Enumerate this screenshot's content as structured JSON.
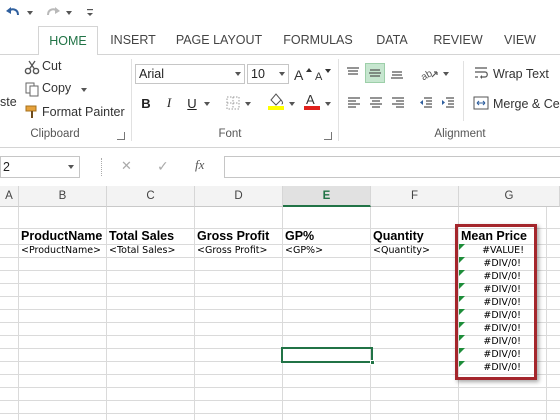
{
  "quick_access": {
    "icons": [
      "undo-icon",
      "redo-icon",
      "customize-qat-icon"
    ]
  },
  "tabs": [
    {
      "label": "HOME",
      "active": true
    },
    {
      "label": "INSERT"
    },
    {
      "label": "PAGE LAYOUT"
    },
    {
      "label": "FORMULAS"
    },
    {
      "label": "DATA"
    },
    {
      "label": "REVIEW"
    },
    {
      "label": "VIEW"
    }
  ],
  "ribbon": {
    "clipboard": {
      "paste_label_partial": "ste",
      "cut_label": "Cut",
      "copy_label": "Copy",
      "format_painter_label": "Format Painter",
      "group_label": "Clipboard"
    },
    "font": {
      "font_name": "Arial",
      "font_size": "10",
      "bold": "B",
      "italic": "I",
      "underline": "U",
      "group_label": "Font",
      "fill_color": "#ffff00",
      "font_color": "#e0201b"
    },
    "alignment": {
      "wrap_text_label": "Wrap Text",
      "merge_label": "Merge & Cen",
      "group_label": "Alignment"
    }
  },
  "formula_bar": {
    "name_box_value": "2",
    "cancel_symbol": "✕",
    "enter_symbol": "✓",
    "fx_symbol": "fx",
    "content": ""
  },
  "sheet": {
    "columns": [
      "A",
      "B",
      "C",
      "D",
      "E",
      "F",
      "G"
    ],
    "selected_column": "E",
    "headers": [
      "ProductName",
      "Total Sales",
      "Gross Profit",
      "GP%",
      "Quantity",
      "Mean Price"
    ],
    "placeholders": [
      "<ProductName>",
      "<Total Sales>",
      "<Gross Profit>",
      "<GP%>",
      "<Quantity>"
    ],
    "mean_price_values": [
      "#VALUE!",
      "#DIV/0!",
      "#DIV/0!",
      "#DIV/0!",
      "#DIV/0!",
      "#DIV/0!",
      "#DIV/0!",
      "#DIV/0!",
      "#DIV/0!",
      "#DIV/0!"
    ],
    "highlight_color": "#a4262c",
    "accent_color": "#217346"
  }
}
